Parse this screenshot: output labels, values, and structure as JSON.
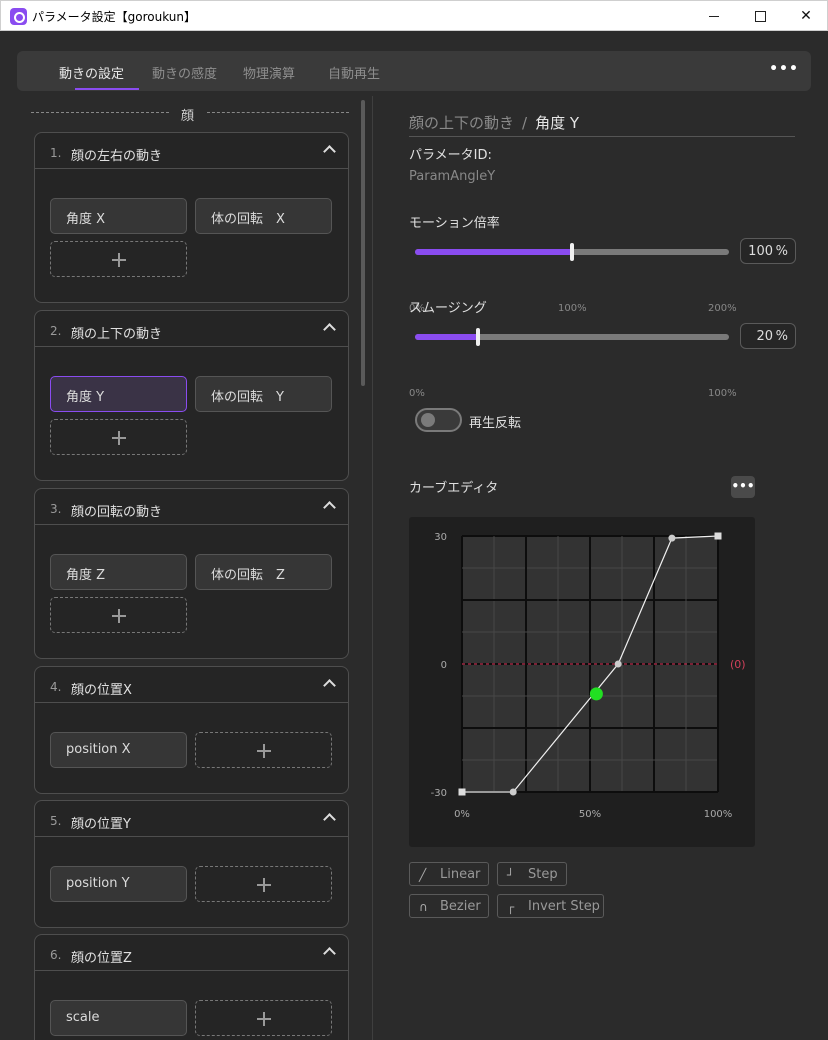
{
  "window": {
    "title": "パラメータ設定【goroukun】"
  },
  "tabs": [
    {
      "label": "動きの設定",
      "active": true
    },
    {
      "label": "動きの感度",
      "active": false
    },
    {
      "label": "物理演算",
      "active": false
    },
    {
      "label": "自動再生",
      "active": false
    }
  ],
  "more_label": "•••",
  "section_label": "顔",
  "cards": [
    {
      "num": "1.",
      "title": "顔の左右の動き",
      "buttons": [
        "角度 X",
        "体の回転　X"
      ]
    },
    {
      "num": "2.",
      "title": "顔の上下の動き",
      "buttons": [
        "角度 Y",
        "体の回転　Y"
      ],
      "selected": 0
    },
    {
      "num": "3.",
      "title": "顔の回転の動き",
      "buttons": [
        "角度 Z",
        "体の回転　Z"
      ]
    },
    {
      "num": "4.",
      "title": "顔の位置X",
      "buttons": [
        "position X"
      ]
    },
    {
      "num": "5.",
      "title": "顔の位置Y",
      "buttons": [
        "position Y"
      ]
    },
    {
      "num": "6.",
      "title": "顔の位置Z",
      "buttons": [
        "scale"
      ]
    }
  ],
  "detail": {
    "breadcrumb_parent": "顔の上下の動き",
    "breadcrumb_sep": "/",
    "breadcrumb_current": "角度 Y",
    "param_id_label": "パラメータID:",
    "param_id_value": "ParamAngleY",
    "motion_label": "モーション倍率",
    "motion_value": "100",
    "motion_unit": "%",
    "motion_fraction": 0.5,
    "motion_ticks": [
      "0%",
      "100%",
      "200%"
    ],
    "smoothing_label": "スムージング",
    "smoothing_value": "20",
    "smoothing_unit": "%",
    "smoothing_fraction": 0.2,
    "smoothing_ticks": [
      "0%",
      "100%"
    ],
    "reverse_label": "再生反転",
    "reverse_on": false,
    "curve_editor_label": "カーブエディタ",
    "curve_more_label": "•••"
  },
  "curve": {
    "y_ticks": [
      "30",
      "0",
      "-30"
    ],
    "x_ticks": [
      "0%",
      "50%",
      "100%"
    ],
    "zero_label": "(0)",
    "points": [
      [
        0,
        -30
      ],
      [
        20,
        -30
      ],
      [
        61,
        0
      ],
      [
        82,
        29.5
      ],
      [
        100,
        30
      ]
    ],
    "current": [
      52.5,
      -7
    ],
    "current_color": "#22e022",
    "zero_line_color": "#c03050"
  },
  "interpolation": [
    {
      "icon": "linear-icon",
      "label": "Linear"
    },
    {
      "icon": "step-icon",
      "label": "Step"
    },
    {
      "icon": "bezier-icon",
      "label": "Bezier"
    },
    {
      "icon": "invert-step-icon",
      "label": "Invert Step"
    }
  ],
  "accent_color": "#8a4cf0"
}
